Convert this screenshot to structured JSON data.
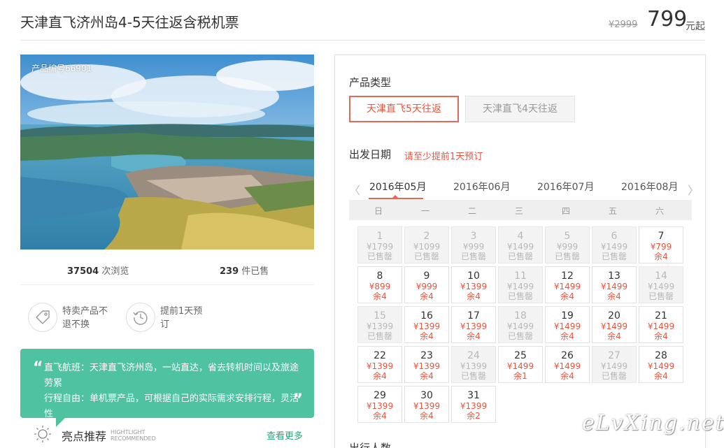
{
  "header": {
    "title": "天津直飞济州岛4-5天往返含税机票",
    "original_price": "¥2999",
    "price": "799",
    "price_unit": "元起"
  },
  "product": {
    "code_label": "产品编号66901",
    "views_count": "37504",
    "views_label": "次浏览",
    "sold_count": "239",
    "sold_label": "件已售"
  },
  "features": [
    {
      "icon": "tag-icon",
      "text": "特卖产品不退不换"
    },
    {
      "icon": "history-clock-icon",
      "text": "提前1天预订"
    }
  ],
  "quote": {
    "open": "“",
    "close": "”",
    "line1": "直飞航班：天津直飞济州岛，一站直达，省去转机时间以及旅途劳累",
    "line2": "行程自由：单机票产品，可根据自己的实际需求安排行程，灵活性"
  },
  "highlight": {
    "icon": "sun-icon",
    "label": "亮点推荐",
    "sub1": "HIGHTLIGHT",
    "sub2": "RECOMMENDED",
    "see_more": "查看更多"
  },
  "booking": {
    "type_label": "产品类型",
    "types": [
      {
        "label": "天津直飞5天往返",
        "active": true
      },
      {
        "label": "天津直飞4天往返",
        "active": false
      }
    ],
    "date_label": "出发日期",
    "date_hint": "请至少提前1天预订",
    "people_label": "出行人数",
    "prev_arrow": "〈",
    "next_arrow": "〉",
    "months": [
      "2016年05月",
      "2016年06月",
      "2016年07月",
      "2016年08月"
    ],
    "active_month": 0,
    "weekdays": [
      "日",
      "一",
      "二",
      "三",
      "四",
      "五",
      "六"
    ]
  },
  "calendar": [
    {
      "day": "1",
      "price": "¥1799",
      "status": "已售罄",
      "available": false
    },
    {
      "day": "2",
      "price": "¥1099",
      "status": "已售罄",
      "available": false
    },
    {
      "day": "3",
      "price": "¥999",
      "status": "已售罄",
      "available": false
    },
    {
      "day": "4",
      "price": "¥1499",
      "status": "已售罄",
      "available": false
    },
    {
      "day": "5",
      "price": "¥999",
      "status": "已售罄",
      "available": false
    },
    {
      "day": "6",
      "price": "¥1499",
      "status": "已售罄",
      "available": false
    },
    {
      "day": "7",
      "price": "¥799",
      "status": "余4",
      "available": true
    },
    {
      "day": "8",
      "price": "¥899",
      "status": "余4",
      "available": true
    },
    {
      "day": "9",
      "price": "¥999",
      "status": "余4",
      "available": true
    },
    {
      "day": "10",
      "price": "¥1399",
      "status": "余4",
      "available": true
    },
    {
      "day": "11",
      "price": "¥1499",
      "status": "已售罄",
      "available": false
    },
    {
      "day": "12",
      "price": "¥1499",
      "status": "余4",
      "available": true
    },
    {
      "day": "13",
      "price": "¥1499",
      "status": "余4",
      "available": true
    },
    {
      "day": "14",
      "price": "¥1499",
      "status": "已售罄",
      "available": false
    },
    {
      "day": "15",
      "price": "¥1399",
      "status": "已售罄",
      "available": false
    },
    {
      "day": "16",
      "price": "¥1399",
      "status": "余4",
      "available": true
    },
    {
      "day": "17",
      "price": "¥1399",
      "status": "余4",
      "available": true
    },
    {
      "day": "18",
      "price": "¥1499",
      "status": "已售罄",
      "available": false
    },
    {
      "day": "19",
      "price": "¥1499",
      "status": "余4",
      "available": true
    },
    {
      "day": "20",
      "price": "¥1499",
      "status": "余4",
      "available": true
    },
    {
      "day": "21",
      "price": "¥1499",
      "status": "余4",
      "available": true
    },
    {
      "day": "22",
      "price": "¥1399",
      "status": "余4",
      "available": true
    },
    {
      "day": "23",
      "price": "¥1399",
      "status": "余4",
      "available": true
    },
    {
      "day": "24",
      "price": "¥1399",
      "status": "已售罄",
      "available": false
    },
    {
      "day": "25",
      "price": "¥1499",
      "status": "余1",
      "available": true
    },
    {
      "day": "26",
      "price": "¥1499",
      "status": "余4",
      "available": true
    },
    {
      "day": "27",
      "price": "¥1499",
      "status": "已售罄",
      "available": false
    },
    {
      "day": "28",
      "price": "¥1499",
      "status": "余4",
      "available": true
    },
    {
      "day": "29",
      "price": "¥1399",
      "status": "余4",
      "available": true
    },
    {
      "day": "30",
      "price": "¥1399",
      "status": "余4",
      "available": true
    },
    {
      "day": "31",
      "price": "¥1399",
      "status": "余2",
      "available": true
    }
  ],
  "watermark": "eLvXing.net",
  "colors": {
    "accent": "#e8543f",
    "teal": "#4fc3a1",
    "link_green": "#2aa37a"
  }
}
